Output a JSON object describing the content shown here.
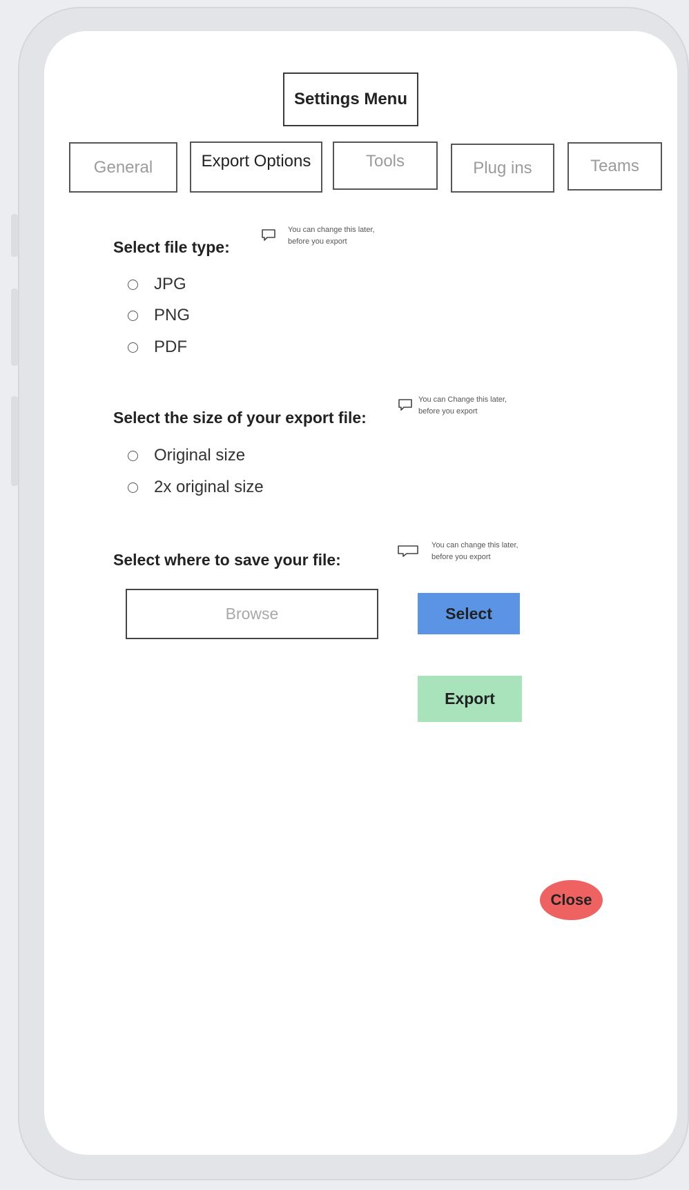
{
  "title": "Settings Menu",
  "tabs": [
    {
      "label": "General",
      "active": false
    },
    {
      "label": "Export Options",
      "active": true
    },
    {
      "label": "Tools",
      "active": false
    },
    {
      "label": "Plug ins",
      "active": false
    },
    {
      "label": "Teams",
      "active": false
    }
  ],
  "file_type": {
    "label": "Select file type:",
    "tooltip": [
      "You can change this later,",
      "before you export"
    ],
    "options": [
      "JPG",
      "PNG",
      "PDF"
    ]
  },
  "size": {
    "label": "Select the size of your export file:",
    "tooltip": [
      "You can Change this later,",
      "before you export"
    ],
    "options": [
      "Original size",
      "2x original size"
    ]
  },
  "save": {
    "label": "Select where to save your file:",
    "tooltip": [
      "You can change this later,",
      "before you export"
    ],
    "browse_placeholder": "Browse",
    "select_label": "Select"
  },
  "actions": {
    "export_label": "Export",
    "close_label": "Close"
  },
  "colors": {
    "select_button": "#5b94e4",
    "export_button": "#a9e3bc",
    "close_button": "#ee6261"
  },
  "icons": [
    "comment-icon"
  ]
}
